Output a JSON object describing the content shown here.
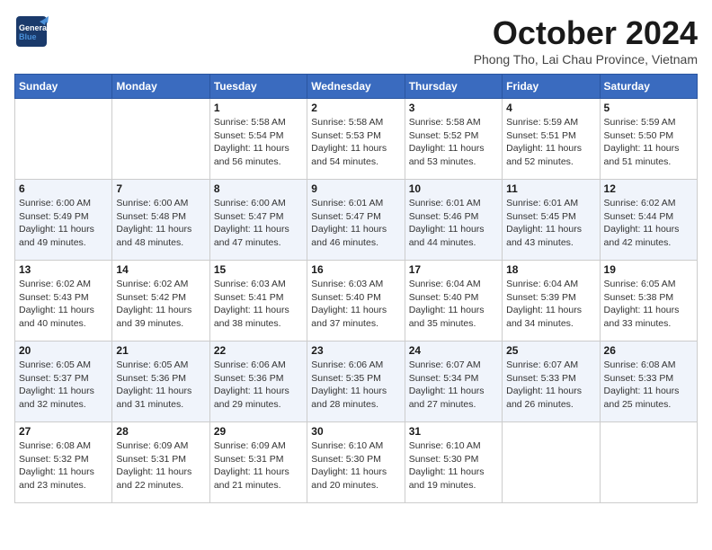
{
  "header": {
    "logo_general": "General",
    "logo_blue": "Blue",
    "month_title": "October 2024",
    "location": "Phong Tho, Lai Chau Province, Vietnam"
  },
  "weekdays": [
    "Sunday",
    "Monday",
    "Tuesday",
    "Wednesday",
    "Thursday",
    "Friday",
    "Saturday"
  ],
  "weeks": [
    [
      {
        "day": "",
        "info": ""
      },
      {
        "day": "",
        "info": ""
      },
      {
        "day": "1",
        "info": "Sunrise: 5:58 AM\nSunset: 5:54 PM\nDaylight: 11 hours and 56 minutes."
      },
      {
        "day": "2",
        "info": "Sunrise: 5:58 AM\nSunset: 5:53 PM\nDaylight: 11 hours and 54 minutes."
      },
      {
        "day": "3",
        "info": "Sunrise: 5:58 AM\nSunset: 5:52 PM\nDaylight: 11 hours and 53 minutes."
      },
      {
        "day": "4",
        "info": "Sunrise: 5:59 AM\nSunset: 5:51 PM\nDaylight: 11 hours and 52 minutes."
      },
      {
        "day": "5",
        "info": "Sunrise: 5:59 AM\nSunset: 5:50 PM\nDaylight: 11 hours and 51 minutes."
      }
    ],
    [
      {
        "day": "6",
        "info": "Sunrise: 6:00 AM\nSunset: 5:49 PM\nDaylight: 11 hours and 49 minutes."
      },
      {
        "day": "7",
        "info": "Sunrise: 6:00 AM\nSunset: 5:48 PM\nDaylight: 11 hours and 48 minutes."
      },
      {
        "day": "8",
        "info": "Sunrise: 6:00 AM\nSunset: 5:47 PM\nDaylight: 11 hours and 47 minutes."
      },
      {
        "day": "9",
        "info": "Sunrise: 6:01 AM\nSunset: 5:47 PM\nDaylight: 11 hours and 46 minutes."
      },
      {
        "day": "10",
        "info": "Sunrise: 6:01 AM\nSunset: 5:46 PM\nDaylight: 11 hours and 44 minutes."
      },
      {
        "day": "11",
        "info": "Sunrise: 6:01 AM\nSunset: 5:45 PM\nDaylight: 11 hours and 43 minutes."
      },
      {
        "day": "12",
        "info": "Sunrise: 6:02 AM\nSunset: 5:44 PM\nDaylight: 11 hours and 42 minutes."
      }
    ],
    [
      {
        "day": "13",
        "info": "Sunrise: 6:02 AM\nSunset: 5:43 PM\nDaylight: 11 hours and 40 minutes."
      },
      {
        "day": "14",
        "info": "Sunrise: 6:02 AM\nSunset: 5:42 PM\nDaylight: 11 hours and 39 minutes."
      },
      {
        "day": "15",
        "info": "Sunrise: 6:03 AM\nSunset: 5:41 PM\nDaylight: 11 hours and 38 minutes."
      },
      {
        "day": "16",
        "info": "Sunrise: 6:03 AM\nSunset: 5:40 PM\nDaylight: 11 hours and 37 minutes."
      },
      {
        "day": "17",
        "info": "Sunrise: 6:04 AM\nSunset: 5:40 PM\nDaylight: 11 hours and 35 minutes."
      },
      {
        "day": "18",
        "info": "Sunrise: 6:04 AM\nSunset: 5:39 PM\nDaylight: 11 hours and 34 minutes."
      },
      {
        "day": "19",
        "info": "Sunrise: 6:05 AM\nSunset: 5:38 PM\nDaylight: 11 hours and 33 minutes."
      }
    ],
    [
      {
        "day": "20",
        "info": "Sunrise: 6:05 AM\nSunset: 5:37 PM\nDaylight: 11 hours and 32 minutes."
      },
      {
        "day": "21",
        "info": "Sunrise: 6:05 AM\nSunset: 5:36 PM\nDaylight: 11 hours and 31 minutes."
      },
      {
        "day": "22",
        "info": "Sunrise: 6:06 AM\nSunset: 5:36 PM\nDaylight: 11 hours and 29 minutes."
      },
      {
        "day": "23",
        "info": "Sunrise: 6:06 AM\nSunset: 5:35 PM\nDaylight: 11 hours and 28 minutes."
      },
      {
        "day": "24",
        "info": "Sunrise: 6:07 AM\nSunset: 5:34 PM\nDaylight: 11 hours and 27 minutes."
      },
      {
        "day": "25",
        "info": "Sunrise: 6:07 AM\nSunset: 5:33 PM\nDaylight: 11 hours and 26 minutes."
      },
      {
        "day": "26",
        "info": "Sunrise: 6:08 AM\nSunset: 5:33 PM\nDaylight: 11 hours and 25 minutes."
      }
    ],
    [
      {
        "day": "27",
        "info": "Sunrise: 6:08 AM\nSunset: 5:32 PM\nDaylight: 11 hours and 23 minutes."
      },
      {
        "day": "28",
        "info": "Sunrise: 6:09 AM\nSunset: 5:31 PM\nDaylight: 11 hours and 22 minutes."
      },
      {
        "day": "29",
        "info": "Sunrise: 6:09 AM\nSunset: 5:31 PM\nDaylight: 11 hours and 21 minutes."
      },
      {
        "day": "30",
        "info": "Sunrise: 6:10 AM\nSunset: 5:30 PM\nDaylight: 11 hours and 20 minutes."
      },
      {
        "day": "31",
        "info": "Sunrise: 6:10 AM\nSunset: 5:30 PM\nDaylight: 11 hours and 19 minutes."
      },
      {
        "day": "",
        "info": ""
      },
      {
        "day": "",
        "info": ""
      }
    ]
  ]
}
